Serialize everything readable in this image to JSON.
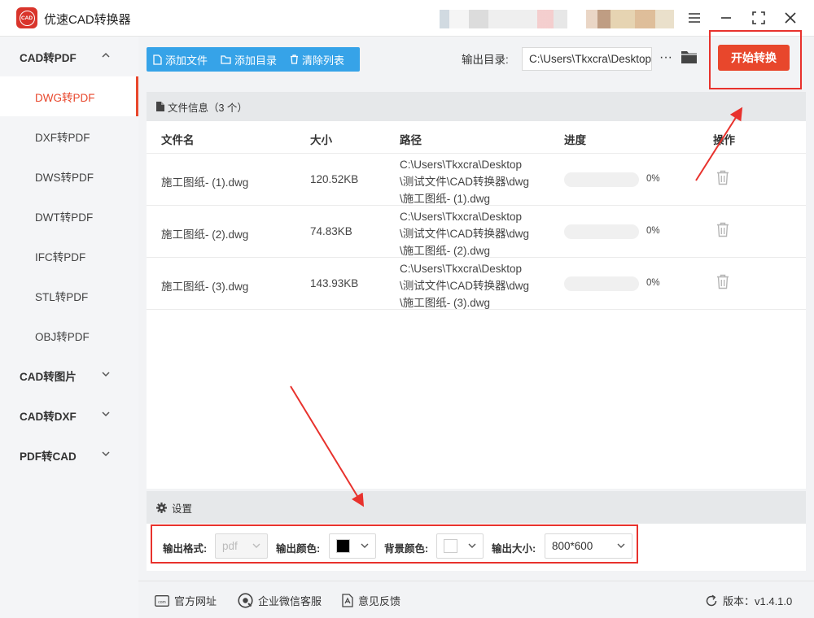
{
  "app": {
    "title": "优速CAD转换器",
    "logo_text": "CAD"
  },
  "sidebar": {
    "groups": [
      {
        "label": "CAD转PDF",
        "expanded": true,
        "items": [
          "DWG转PDF",
          "DXF转PDF",
          "DWS转PDF",
          "DWT转PDF",
          "IFC转PDF",
          "STL转PDF",
          "OBJ转PDF"
        ],
        "active": "DWG转PDF"
      },
      {
        "label": "CAD转图片",
        "expanded": false
      },
      {
        "label": "CAD转DXF",
        "expanded": false
      },
      {
        "label": "PDF转CAD",
        "expanded": false
      }
    ]
  },
  "toolbar": {
    "add_file": "添加文件",
    "add_dir": "添加目录",
    "clear_list": "清除列表",
    "output_label": "输出目录:",
    "output_path": "C:\\Users\\Tkxcra\\Desktop",
    "more": "···",
    "start": "开始转换"
  },
  "file_panel": {
    "title": "文件信息（3 个）",
    "columns": {
      "name": "文件名",
      "size": "大小",
      "path": "路径",
      "progress": "进度",
      "action": "操作"
    },
    "rows": [
      {
        "name": "施工图纸- (1).dwg",
        "size": "120.52KB",
        "path": "C:\\Users\\Tkxcra\\Desktop\n\\测试文件\\CAD转换器\\dwg\n\\施工图纸- (1).dwg",
        "progress": 0,
        "progress_text": "0%"
      },
      {
        "name": "施工图纸- (2).dwg",
        "size": "74.83KB",
        "path": "C:\\Users\\Tkxcra\\Desktop\n\\测试文件\\CAD转换器\\dwg\n\\施工图纸- (2).dwg",
        "progress": 0,
        "progress_text": "0%"
      },
      {
        "name": "施工图纸- (3).dwg",
        "size": "143.93KB",
        "path": "C:\\Users\\Tkxcra\\Desktop\n\\测试文件\\CAD转换器\\dwg\n\\施工图纸- (3).dwg",
        "progress": 0,
        "progress_text": "0%"
      }
    ]
  },
  "settings": {
    "title": "设置",
    "format_label": "输出格式:",
    "format_value": "pdf",
    "color_label": "输出颜色:",
    "color_value": "#000000",
    "bg_label": "背景颜色:",
    "bg_value": "#ffffff",
    "size_label": "输出大小:",
    "size_value": "800*600"
  },
  "footer": {
    "website": "官方网址",
    "wechat": "企业微信客服",
    "feedback": "意见反馈",
    "version": "版本：v1.4.1.0"
  },
  "colors": {
    "accent": "#e8472c",
    "toolbar_blue": "#36a3e8",
    "annotation_red": "#e8322d"
  }
}
